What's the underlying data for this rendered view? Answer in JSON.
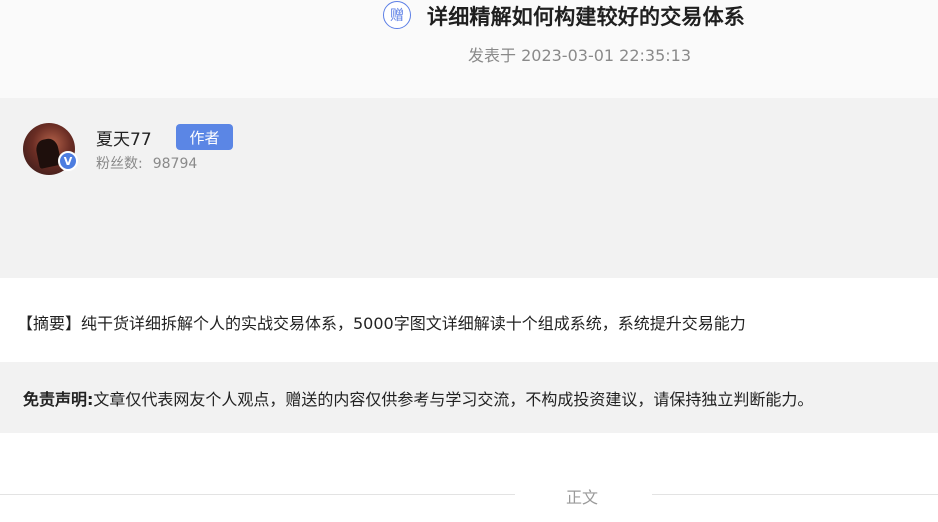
{
  "header": {
    "gift_icon_label": "赠",
    "title": "详细精解如何构建较好的交易体系",
    "date": "发表于 2023-03-01 22:35:13"
  },
  "author": {
    "name": "夏天77",
    "badge": "作者",
    "fans_label": "粉丝数:",
    "fans_value": "98794",
    "verified_icon": "V"
  },
  "summary": {
    "text": "【摘要】纯干货详细拆解个人的实战交易体系，5000字图文详细解读十个组成系统，系统提升交易能力"
  },
  "disclaimer": {
    "label": "免责声明:",
    "text": "文章仅代表网友个人观点，赠送的内容仅供参考与学习交流，不构成投资建议，请保持独立判断能力。"
  },
  "divider": {
    "label": "正文"
  },
  "colors": {
    "accent": "#5b86e5",
    "gray_bg": "#f2f2f2"
  }
}
